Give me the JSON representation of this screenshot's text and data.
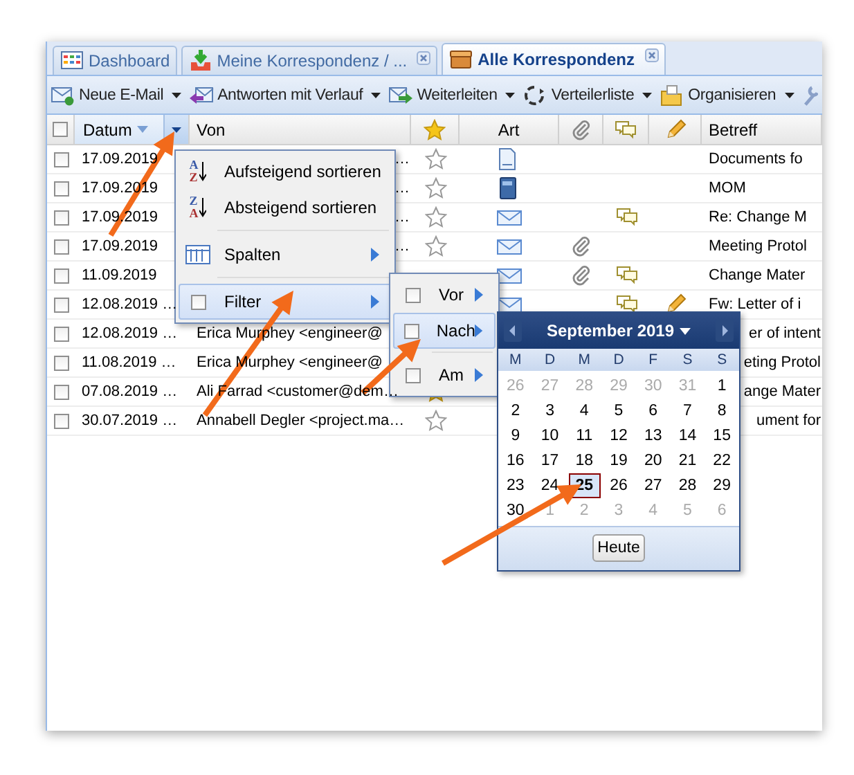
{
  "tabs": [
    {
      "label": "Dashboard",
      "selected": false,
      "closable": false
    },
    {
      "label": "Meine Korrespondenz / ...",
      "selected": false,
      "closable": true
    },
    {
      "label": "Alle Korrespondenz",
      "selected": true,
      "closable": true
    }
  ],
  "toolbar": [
    {
      "label": "Neue E-Mail",
      "dropdown": true
    },
    {
      "label": "Antworten mit Verlauf",
      "dropdown": true
    },
    {
      "label": "Weiterleiten",
      "dropdown": true
    },
    {
      "label": "Verteilerliste",
      "dropdown": true
    },
    {
      "label": "Organisieren",
      "dropdown": true
    }
  ],
  "table": {
    "header_checked": false,
    "columns": [
      {
        "kind": "check"
      },
      {
        "kind": "text",
        "label": "Datum",
        "sorted": true,
        "menu_open": true
      },
      {
        "kind": "text",
        "label": "Von"
      },
      {
        "kind": "star"
      },
      {
        "kind": "centered_text",
        "label": "Art"
      },
      {
        "kind": "clip"
      },
      {
        "kind": "comment"
      },
      {
        "kind": "pencil"
      },
      {
        "kind": "text",
        "label": "Betreff"
      }
    ],
    "rows": [
      {
        "checked": false,
        "datum": "17.09.2019",
        "von": {
          "kind": "tail",
          "text": "…"
        },
        "starred": false,
        "art": {
          "kind": "document"
        },
        "attachment": false,
        "comment": false,
        "edited": false,
        "betreff": {
          "kind": "head",
          "text": "Documents fo"
        }
      },
      {
        "checked": false,
        "datum": "17.09.2019",
        "von": {
          "kind": "tail",
          "text": "…"
        },
        "starred": false,
        "art": {
          "kind": "book"
        },
        "attachment": false,
        "comment": false,
        "edited": false,
        "betreff": {
          "kind": "head",
          "text": "MOM"
        }
      },
      {
        "checked": false,
        "datum": "17.09.2019",
        "von": {
          "kind": "tail",
          "text": "…"
        },
        "starred": false,
        "art": {
          "kind": "mail"
        },
        "attachment": false,
        "comment": true,
        "edited": false,
        "betreff": {
          "kind": "head",
          "text": "Re: Change M"
        }
      },
      {
        "checked": false,
        "datum": "17.09.2019",
        "von": {
          "kind": "tail",
          "text": "…"
        },
        "starred": false,
        "art": {
          "kind": "mail"
        },
        "attachment": true,
        "comment": false,
        "edited": false,
        "betreff": {
          "kind": "head",
          "text": "Meeting Protol"
        }
      },
      {
        "checked": false,
        "datum": "11.09.2019",
        "art": {
          "kind": "mail"
        },
        "attachment": true,
        "comment": true,
        "edited": false,
        "betreff": {
          "kind": "head",
          "text": "Change Mater"
        }
      },
      {
        "checked": false,
        "datum": "12.08.2019 …",
        "art": {
          "kind": "mail"
        },
        "attachment": false,
        "comment": true,
        "edited": true,
        "betreff": {
          "kind": "head",
          "text": "Fw: Letter of i"
        }
      },
      {
        "checked": false,
        "datum": "12.08.2019 …",
        "von": {
          "kind": "head",
          "text": "Erica Murphey <engineer@"
        },
        "betreff": {
          "kind": "tail",
          "text": "er of intent"
        }
      },
      {
        "checked": false,
        "datum": "11.08.2019 …",
        "von": {
          "kind": "head",
          "text": "Erica Murphey <engineer@"
        },
        "betreff": {
          "kind": "tail",
          "text": "eting Protol"
        }
      },
      {
        "checked": false,
        "datum": "07.08.2019 …",
        "von": {
          "kind": "head",
          "text": "Ali Farrad <customer@dem…"
        },
        "starred": true,
        "betreff": {
          "kind": "tail",
          "text": "ange Mater"
        }
      },
      {
        "checked": false,
        "datum": "30.07.2019 …",
        "von": {
          "kind": "head",
          "text": "Annabell Degler <project.ma…"
        },
        "starred": false,
        "betreff": {
          "kind": "tail",
          "text": "ument for"
        }
      }
    ]
  },
  "column_menu": {
    "items": [
      {
        "kind": "sort",
        "label": "Aufsteigend sortieren",
        "icon_letters": [
          "A",
          "Z"
        ]
      },
      {
        "kind": "sort",
        "label": "Absteigend sortieren",
        "icon_letters": [
          "Z",
          "A"
        ]
      },
      {
        "kind": "separator"
      },
      {
        "kind": "columns",
        "label": "Spalten",
        "submenu": true,
        "active": false
      },
      {
        "kind": "separator"
      },
      {
        "kind": "check",
        "label": "Filter",
        "checked": false,
        "submenu": true,
        "active": true
      }
    ]
  },
  "filter_menu": {
    "items": [
      {
        "kind": "check",
        "label": "Vor",
        "checked": false,
        "active": false
      },
      {
        "kind": "check",
        "label": "Nach",
        "checked": false,
        "active": true
      },
      {
        "kind": "separator"
      },
      {
        "kind": "check",
        "label": "Am",
        "checked": false,
        "active": false
      }
    ]
  },
  "date_picker": {
    "month": "September 2019",
    "weekdays": [
      "M",
      "D",
      "M",
      "D",
      "F",
      "S",
      "S"
    ],
    "weeks": [
      [
        {
          "day": "26",
          "other_month": true
        },
        {
          "day": "27",
          "other_month": true
        },
        {
          "day": "28",
          "other_month": true
        },
        {
          "day": "29",
          "other_month": true
        },
        {
          "day": "30",
          "other_month": true
        },
        {
          "day": "31",
          "other_month": true
        },
        {
          "day": "1",
          "other_month": false
        }
      ],
      [
        {
          "day": "2",
          "other_month": false
        },
        {
          "day": "3",
          "other_month": false
        },
        {
          "day": "4",
          "other_month": false
        },
        {
          "day": "5",
          "other_month": false
        },
        {
          "day": "6",
          "other_month": false
        },
        {
          "day": "7",
          "other_month": false
        },
        {
          "day": "8",
          "other_month": false
        }
      ],
      [
        {
          "day": "9",
          "other_month": false
        },
        {
          "day": "10",
          "other_month": false
        },
        {
          "day": "11",
          "other_month": false
        },
        {
          "day": "12",
          "other_month": false
        },
        {
          "day": "13",
          "other_month": false
        },
        {
          "day": "14",
          "other_month": false
        },
        {
          "day": "15",
          "other_month": false
        }
      ],
      [
        {
          "day": "16",
          "other_month": false
        },
        {
          "day": "17",
          "other_month": false
        },
        {
          "day": "18",
          "other_month": false
        },
        {
          "day": "19",
          "other_month": false
        },
        {
          "day": "20",
          "other_month": false
        },
        {
          "day": "21",
          "other_month": false
        },
        {
          "day": "22",
          "other_month": false
        }
      ],
      [
        {
          "day": "23",
          "other_month": false
        },
        {
          "day": "24",
          "other_month": false
        },
        {
          "day": "25",
          "other_month": false,
          "selected": true
        },
        {
          "day": "26",
          "other_month": false
        },
        {
          "day": "27",
          "other_month": false
        },
        {
          "day": "28",
          "other_month": false
        },
        {
          "day": "29",
          "other_month": false
        }
      ],
      [
        {
          "day": "30",
          "other_month": false
        },
        {
          "day": "1",
          "other_month": true
        },
        {
          "day": "2",
          "other_month": true
        },
        {
          "day": "3",
          "other_month": true
        },
        {
          "day": "4",
          "other_month": true
        },
        {
          "day": "5",
          "other_month": true
        },
        {
          "day": "6",
          "other_month": true
        }
      ]
    ],
    "today_button": "Heute"
  }
}
